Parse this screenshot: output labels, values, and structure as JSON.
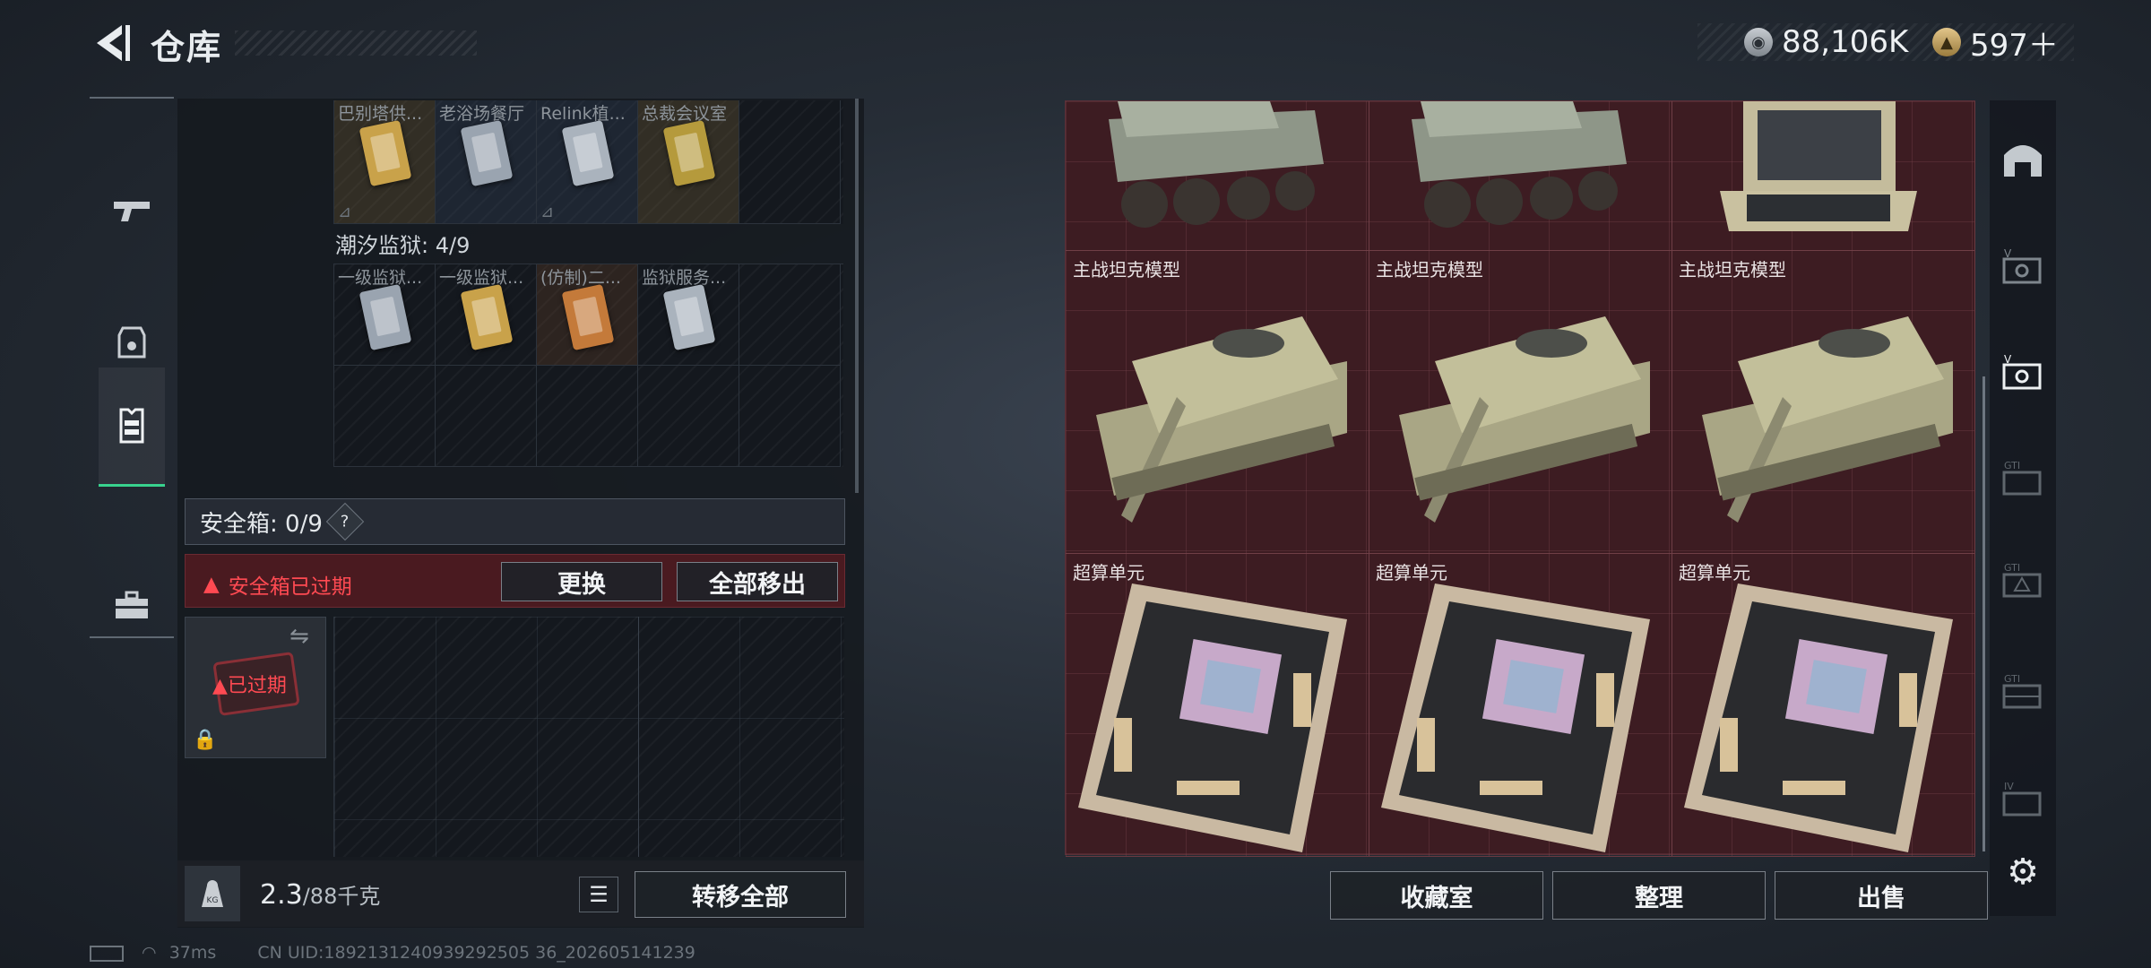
{
  "header": {
    "title": "仓库"
  },
  "currency": {
    "coins": "88,106K",
    "tokens": "597＋"
  },
  "left_nav": {
    "items": [
      "gun-icon",
      "backpack-icon",
      "vest-icon",
      "toolbox-icon"
    ],
    "active_index": 2
  },
  "left_panel": {
    "top_row_labels": [
      "巴别塔供...",
      "老浴场餐厅",
      "Relink植...",
      "总裁会议室",
      ""
    ],
    "section_title": "潮汐监狱: 4/9",
    "section_labels": [
      "一级监狱...",
      "一级监狱...",
      "(仿制)二...",
      "监狱服务...",
      ""
    ],
    "safe_header": "安全箱: 0/9",
    "help": "?",
    "expired_text": "安全箱已过期",
    "replace_btn": "更换",
    "remove_all_btn": "全部移出",
    "expired_badge": "已过期",
    "weight_value": "2.3",
    "weight_max": "/88千克",
    "kg_label": "KG",
    "transfer_all_btn": "转移全部"
  },
  "right_panel": {
    "rows": [
      {
        "label": "",
        "items": [
          "armored-vehicle-model",
          "armored-vehicle-model",
          "laptop-case"
        ]
      },
      {
        "label": "主战坦克模型",
        "items": [
          "tank-model",
          "tank-model",
          "tank-model"
        ]
      },
      {
        "label": "超算单元",
        "items": [
          "supercomputer-unit",
          "supercomputer-unit",
          "supercomputer-unit"
        ]
      }
    ],
    "buttons": {
      "collection": "收藏室",
      "organize": "整理",
      "sell": "出售"
    }
  },
  "status": {
    "latency": "37ms",
    "uid": "CN UID:1892131240939292505 36_202605141239"
  }
}
